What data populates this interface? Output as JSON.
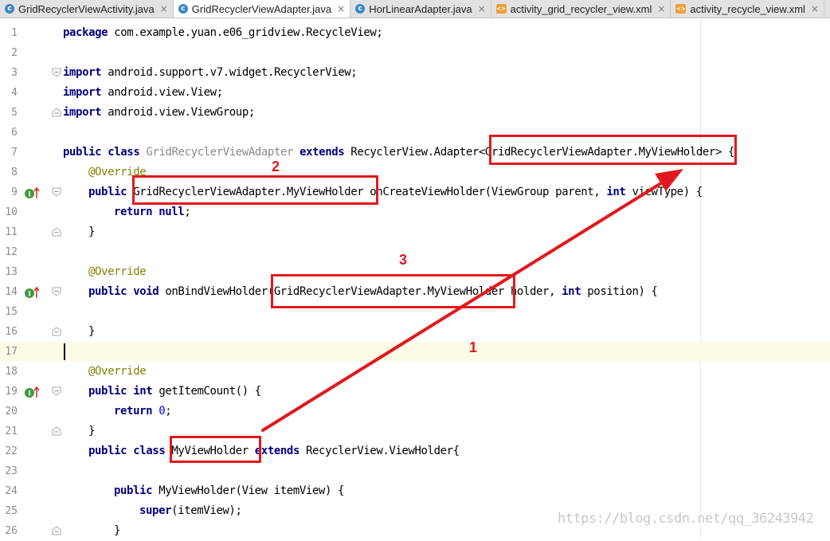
{
  "tabs": [
    {
      "label": "GridRecyclerViewActivity.java",
      "icon": "c",
      "type": "java",
      "active": false
    },
    {
      "label": "GridRecyclerViewAdapter.java",
      "icon": "c",
      "type": "java",
      "active": true
    },
    {
      "label": "HorLinearAdapter.java",
      "icon": "c",
      "type": "java",
      "active": false
    },
    {
      "label": "activity_grid_recycler_view.xml",
      "icon": "<>",
      "type": "xml",
      "active": false
    },
    {
      "label": "activity_recycle_view.xml",
      "icon": "<>",
      "type": "xml",
      "active": false
    }
  ],
  "tab_close_glyph": "×",
  "line_numbers": [
    "1",
    "2",
    "3",
    "4",
    "5",
    "6",
    "7",
    "8",
    "9",
    "10",
    "11",
    "12",
    "13",
    "14",
    "15",
    "16",
    "17",
    "18",
    "19",
    "20",
    "21",
    "22",
    "23",
    "24",
    "25",
    "26"
  ],
  "code": {
    "l1_kw": "package",
    "l1_rest": " com.example.yuan.e06_gridview.RecycleView;",
    "l3_kw": "import",
    "l3_rest": " android.support.v7.widget.RecyclerView;",
    "l4_kw": "import",
    "l4_rest": " android.view.View;",
    "l5_kw": "import",
    "l5_rest": " android.view.ViewGroup;",
    "l7_kw1": "public class",
    "l7_name": " GridRecyclerViewAdapter ",
    "l7_kw2": "extends",
    "l7_rest": " RecyclerView.Adapter<GridRecyclerViewAdapter.MyViewHolder> {",
    "l8_anno": "@Override",
    "l9_kw": "public",
    "l9_a": " GridRecyclerViewAdapter.MyViewHolder onCreateViewHolder(ViewGroup parent, ",
    "l9_kw2": "int",
    "l9_b": " viewType) {",
    "l10_kw": "return null",
    "l10_rest": ";",
    "l11": "}",
    "l13_anno": "@Override",
    "l14_kw": "public void",
    "l14_a": " onBindViewHolder(GridRecyclerViewAdapter.MyViewHolder holder, ",
    "l14_kw2": "int",
    "l14_b": " position) {",
    "l16": "}",
    "l18_anno": "@Override",
    "l19_kw": "public int",
    "l19_rest": " getItemCount() {",
    "l20_kw": "return",
    "l20_num": " 0",
    "l20_rest": ";",
    "l21": "}",
    "l22_kw1": "public class",
    "l22_a": " MyViewHolder ",
    "l22_kw2": "extends",
    "l22_b": " RecyclerView.ViewHolder{",
    "l24_kw": "public",
    "l24_rest": " MyViewHolder(View itemView) {",
    "l25_kw": "super",
    "l25_rest": "(itemView);",
    "l26": "}"
  },
  "annotations": {
    "label_1": "1",
    "label_2": "2",
    "label_3": "3",
    "color": "#e1191e"
  },
  "watermark": "https://blog.csdn.net/qq_36243942",
  "colors": {
    "keyword": "#000080",
    "annotation": "#808000",
    "inactive_class_name": "#8a8a8a",
    "number": "#0000ff",
    "current_line": "#fdfbe6"
  }
}
